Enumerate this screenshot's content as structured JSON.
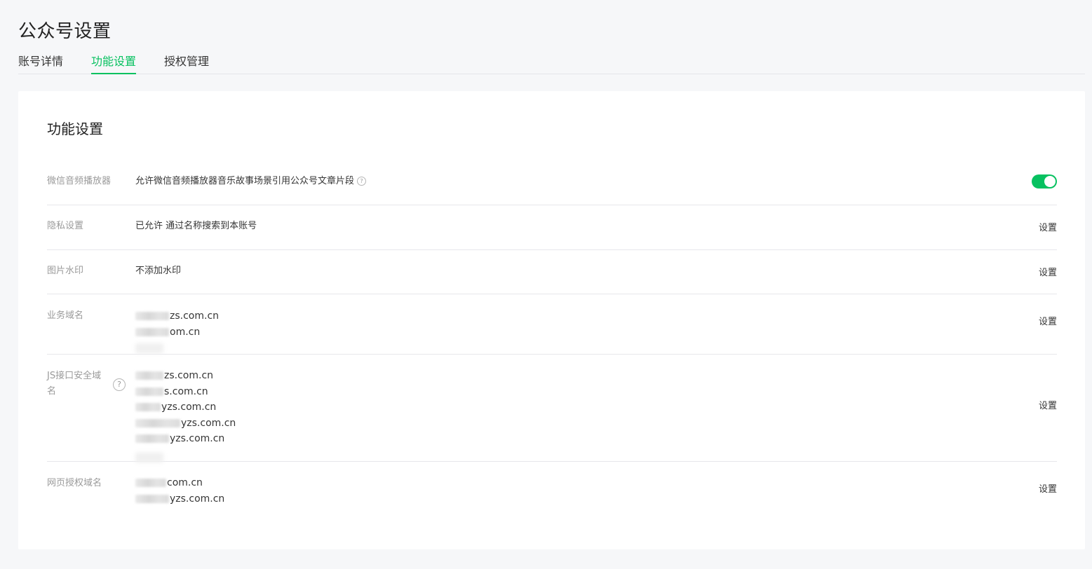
{
  "page": {
    "title": "公众号设置"
  },
  "tabs": [
    {
      "label": "账号详情"
    },
    {
      "label": "功能设置"
    },
    {
      "label": "授权管理"
    }
  ],
  "section": {
    "title": "功能设置"
  },
  "rows": {
    "audio_player": {
      "label": "微信音频播放器",
      "description": "允许微信音频播放器音乐故事场景引用公众号文章片段",
      "toggle_on": true
    },
    "privacy": {
      "label": "隐私设置",
      "value": "已允许 通过名称搜索到本账号",
      "action": "设置"
    },
    "watermark": {
      "label": "图片水印",
      "value": "不添加水印",
      "action": "设置"
    },
    "business_domain": {
      "label": "业务域名",
      "domains": [
        "zs.com.cn",
        "om.cn"
      ],
      "action": "设置"
    },
    "js_domain": {
      "label": "JS接口安全域名",
      "domains": [
        "zs.com.cn",
        "s.com.cn",
        "yzs.com.cn",
        "yzs.com.cn",
        "yzs.com.cn"
      ],
      "action": "设置"
    },
    "oauth_domain": {
      "label": "网页授权域名",
      "domains": [
        "com.cn",
        "yzs.com.cn"
      ],
      "action": "设置"
    }
  },
  "colors": {
    "accent": "#07c160",
    "background": "#f6f7f9",
    "card": "#ffffff",
    "label": "#9a9a9a"
  }
}
